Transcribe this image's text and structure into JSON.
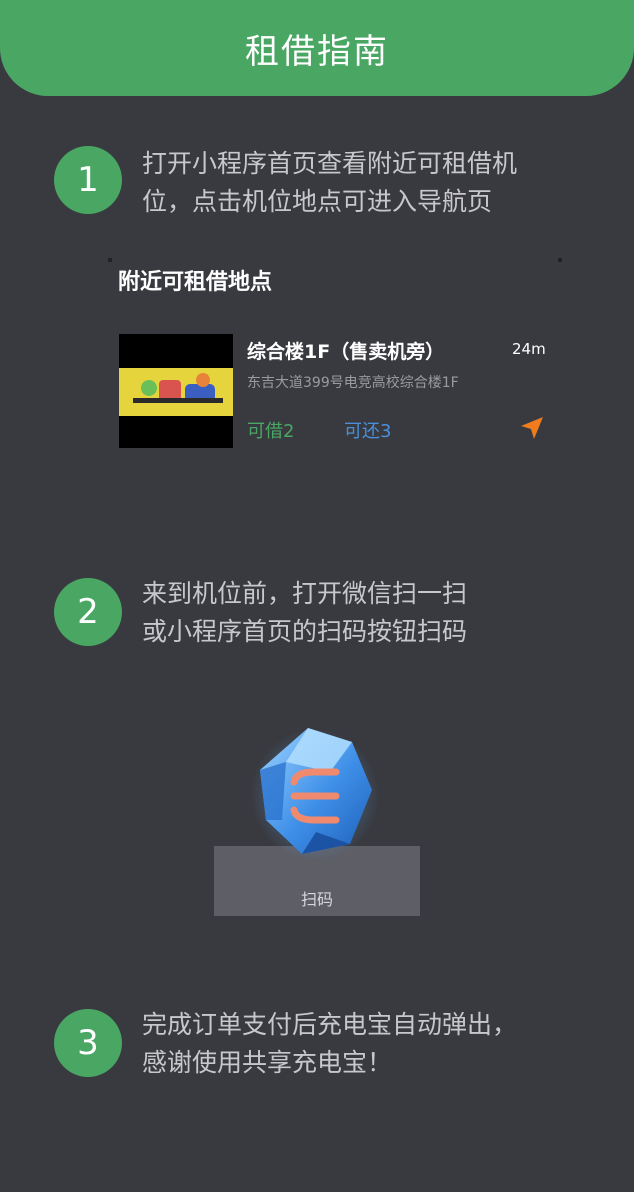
{
  "header": {
    "title": "租借指南"
  },
  "steps": [
    {
      "num": "1",
      "line1": "打开小程序首页查看附近可租借机",
      "line2": "位，点击机位地点可进入导航页"
    },
    {
      "num": "2",
      "line1": "来到机位前，打开微信扫一扫",
      "line2": "或小程序首页的扫码按钮扫码"
    },
    {
      "num": "3",
      "line1": "完成订单支付后充电宝自动弹出，",
      "line2": "感谢使用共享充电宝！"
    }
  ],
  "example": {
    "title": "附近可租借地点",
    "location": {
      "name": "综合楼1F（售卖机旁）",
      "distance": "24m",
      "address": "东吉大道399号电竞高校综合楼1F",
      "borrow": "可借2",
      "return": "可还3"
    }
  },
  "scan": {
    "label": "扫码"
  },
  "colors": {
    "accent": "#4aa663",
    "background": "#393a40",
    "return_blue": "#4a90d8",
    "nav_orange": "#f07c1e"
  },
  "icons": {
    "navigate": "navigation-arrow-icon",
    "scan": "gem-scan-icon"
  }
}
